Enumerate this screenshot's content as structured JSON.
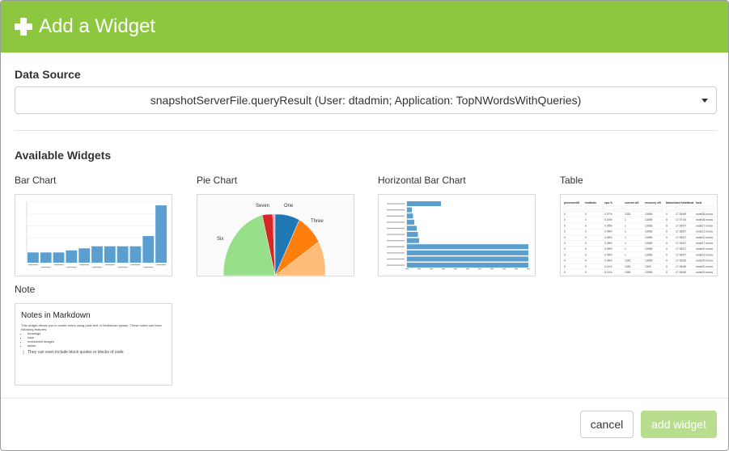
{
  "header": {
    "title": "Add a Widget",
    "icon": "plus-icon",
    "color": "#8dc63f"
  },
  "data_source": {
    "label": "Data Source",
    "selected": "snapshotServerFile.queryResult (User: dtadmin; Application: TopNWordsWithQueries)"
  },
  "widgets": {
    "label": "Available Widgets",
    "items": [
      {
        "name": "Bar Chart"
      },
      {
        "name": "Pie Chart"
      },
      {
        "name": "Horizontal Bar Chart"
      },
      {
        "name": "Table"
      },
      {
        "name": "Note"
      }
    ]
  },
  "thumbs": {
    "bar": {
      "values": [
        5,
        5,
        5,
        6,
        7,
        8,
        8,
        8,
        8,
        13,
        28
      ],
      "color": "#5a9fd0"
    },
    "pie": {
      "labels": [
        "Seven",
        "One",
        "Three",
        "Six"
      ],
      "colors": {
        "Seven": "#d62728",
        "One": "#1f77b4",
        "Three": "#ff7f0e",
        "Six": "#98df8a",
        "other": "#ffbb78"
      }
    },
    "hbar": {
      "values": [
        28,
        4,
        5,
        6,
        8,
        9,
        10,
        100,
        100,
        100,
        100
      ],
      "color": "#5a9fd0"
    },
    "table": {
      "headers": [
        "processedS",
        "emitteds",
        "cpu %",
        "current wS",
        "recovery wS",
        "failures",
        "last heartbeat",
        "host"
      ],
      "rows": [
        [
          "0",
          "0",
          "0.07%",
          "1351",
          "13069",
          "0",
          "17:36:59",
          "node28.mona"
        ],
        [
          "0",
          "0",
          "0.04%",
          "1",
          "13069",
          "0",
          "17:37:44",
          "node18.mona"
        ],
        [
          "0",
          "0",
          "0.05%",
          "1",
          "13069",
          "0",
          "17:36:57",
          "node27.mona"
        ],
        [
          "0",
          "0",
          "0.06%",
          "1",
          "13069",
          "0",
          "17:36:57",
          "node21.mona"
        ],
        [
          "0",
          "0",
          "0.05%",
          "1",
          "13069",
          "0",
          "17:36:57",
          "node22.mona"
        ],
        [
          "0",
          "0",
          "0.08%",
          "1",
          "13069",
          "0",
          "17:36:57",
          "node17.mona"
        ],
        [
          "0",
          "0",
          "0.05%",
          "1",
          "13069",
          "0",
          "17:36:57",
          "node20.mona"
        ],
        [
          "0",
          "0",
          "0.05%",
          "1",
          "13069",
          "0",
          "17:36:57",
          "node23.mona"
        ],
        [
          "0",
          "0",
          "0.06%",
          "1351",
          "13069",
          "0",
          "17:36:56",
          "node25.mona"
        ],
        [
          "0",
          "0",
          "0.11%",
          "1351",
          "1309",
          "0",
          "17:36:56",
          "node20.mona"
        ],
        [
          "0",
          "0",
          "0.11%",
          "1351",
          "13069",
          "0",
          "17:36:56",
          "node19.mona"
        ]
      ]
    },
    "note": {
      "heading": "Notes in Markdown",
      "intro": "This widget allows you to create notes using plain text or Markdown syntax. These notes can have following features:",
      "features": [
        "headings",
        "links",
        "embedded images",
        "styles"
      ],
      "quote": "They can even include block quotes or blocks of code"
    }
  },
  "footer": {
    "cancel_label": "cancel",
    "add_label": "add widget"
  }
}
